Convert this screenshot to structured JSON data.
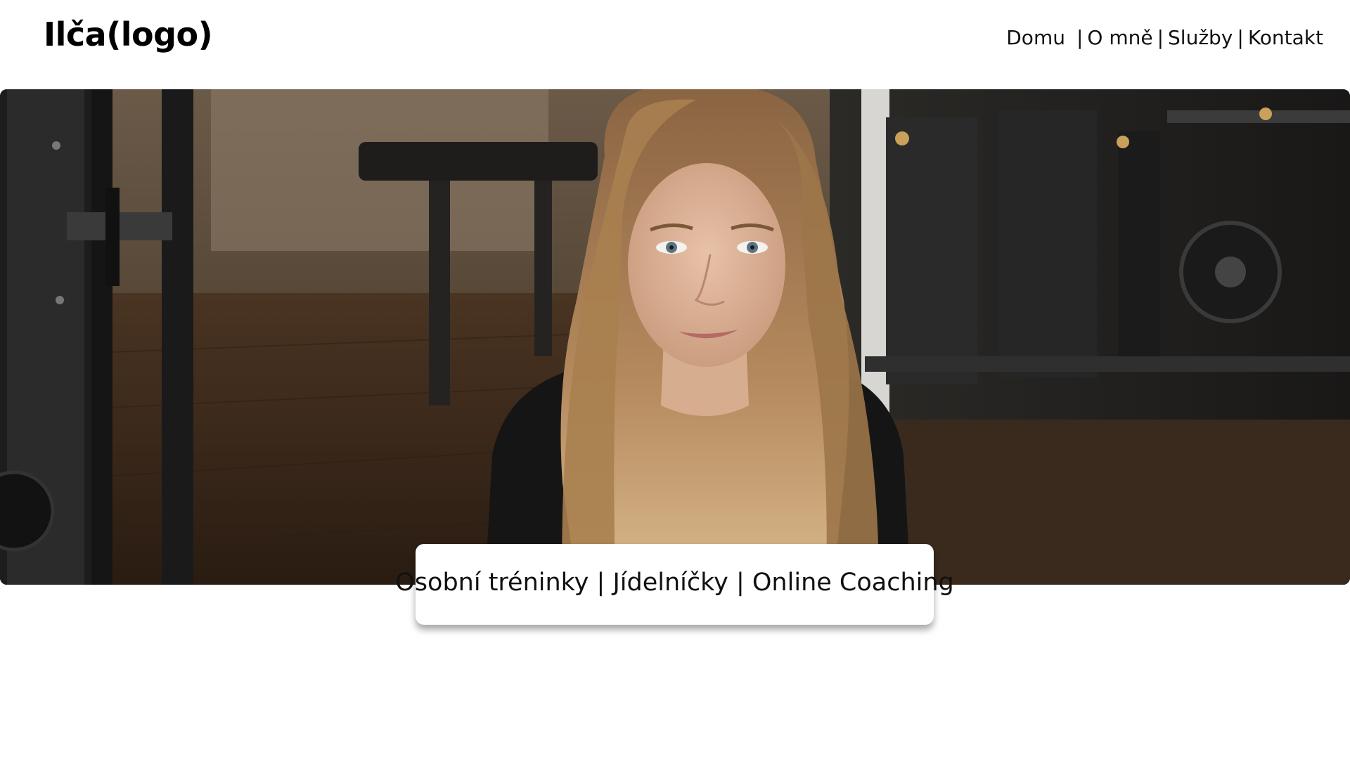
{
  "header": {
    "logo_text": "Ilča(logo)",
    "nav": {
      "items": [
        "Domu",
        "O mně",
        "Služby",
        "Kontakt"
      ],
      "separator": "|"
    }
  },
  "hero": {
    "image_description": "portrait-photo-gym"
  },
  "tagline": {
    "text": "Osobní tréninky | Jídelníčky | Online Coaching"
  },
  "colors": {
    "background": "#ffffff",
    "text": "#111111",
    "card_background": "#ffffff"
  }
}
